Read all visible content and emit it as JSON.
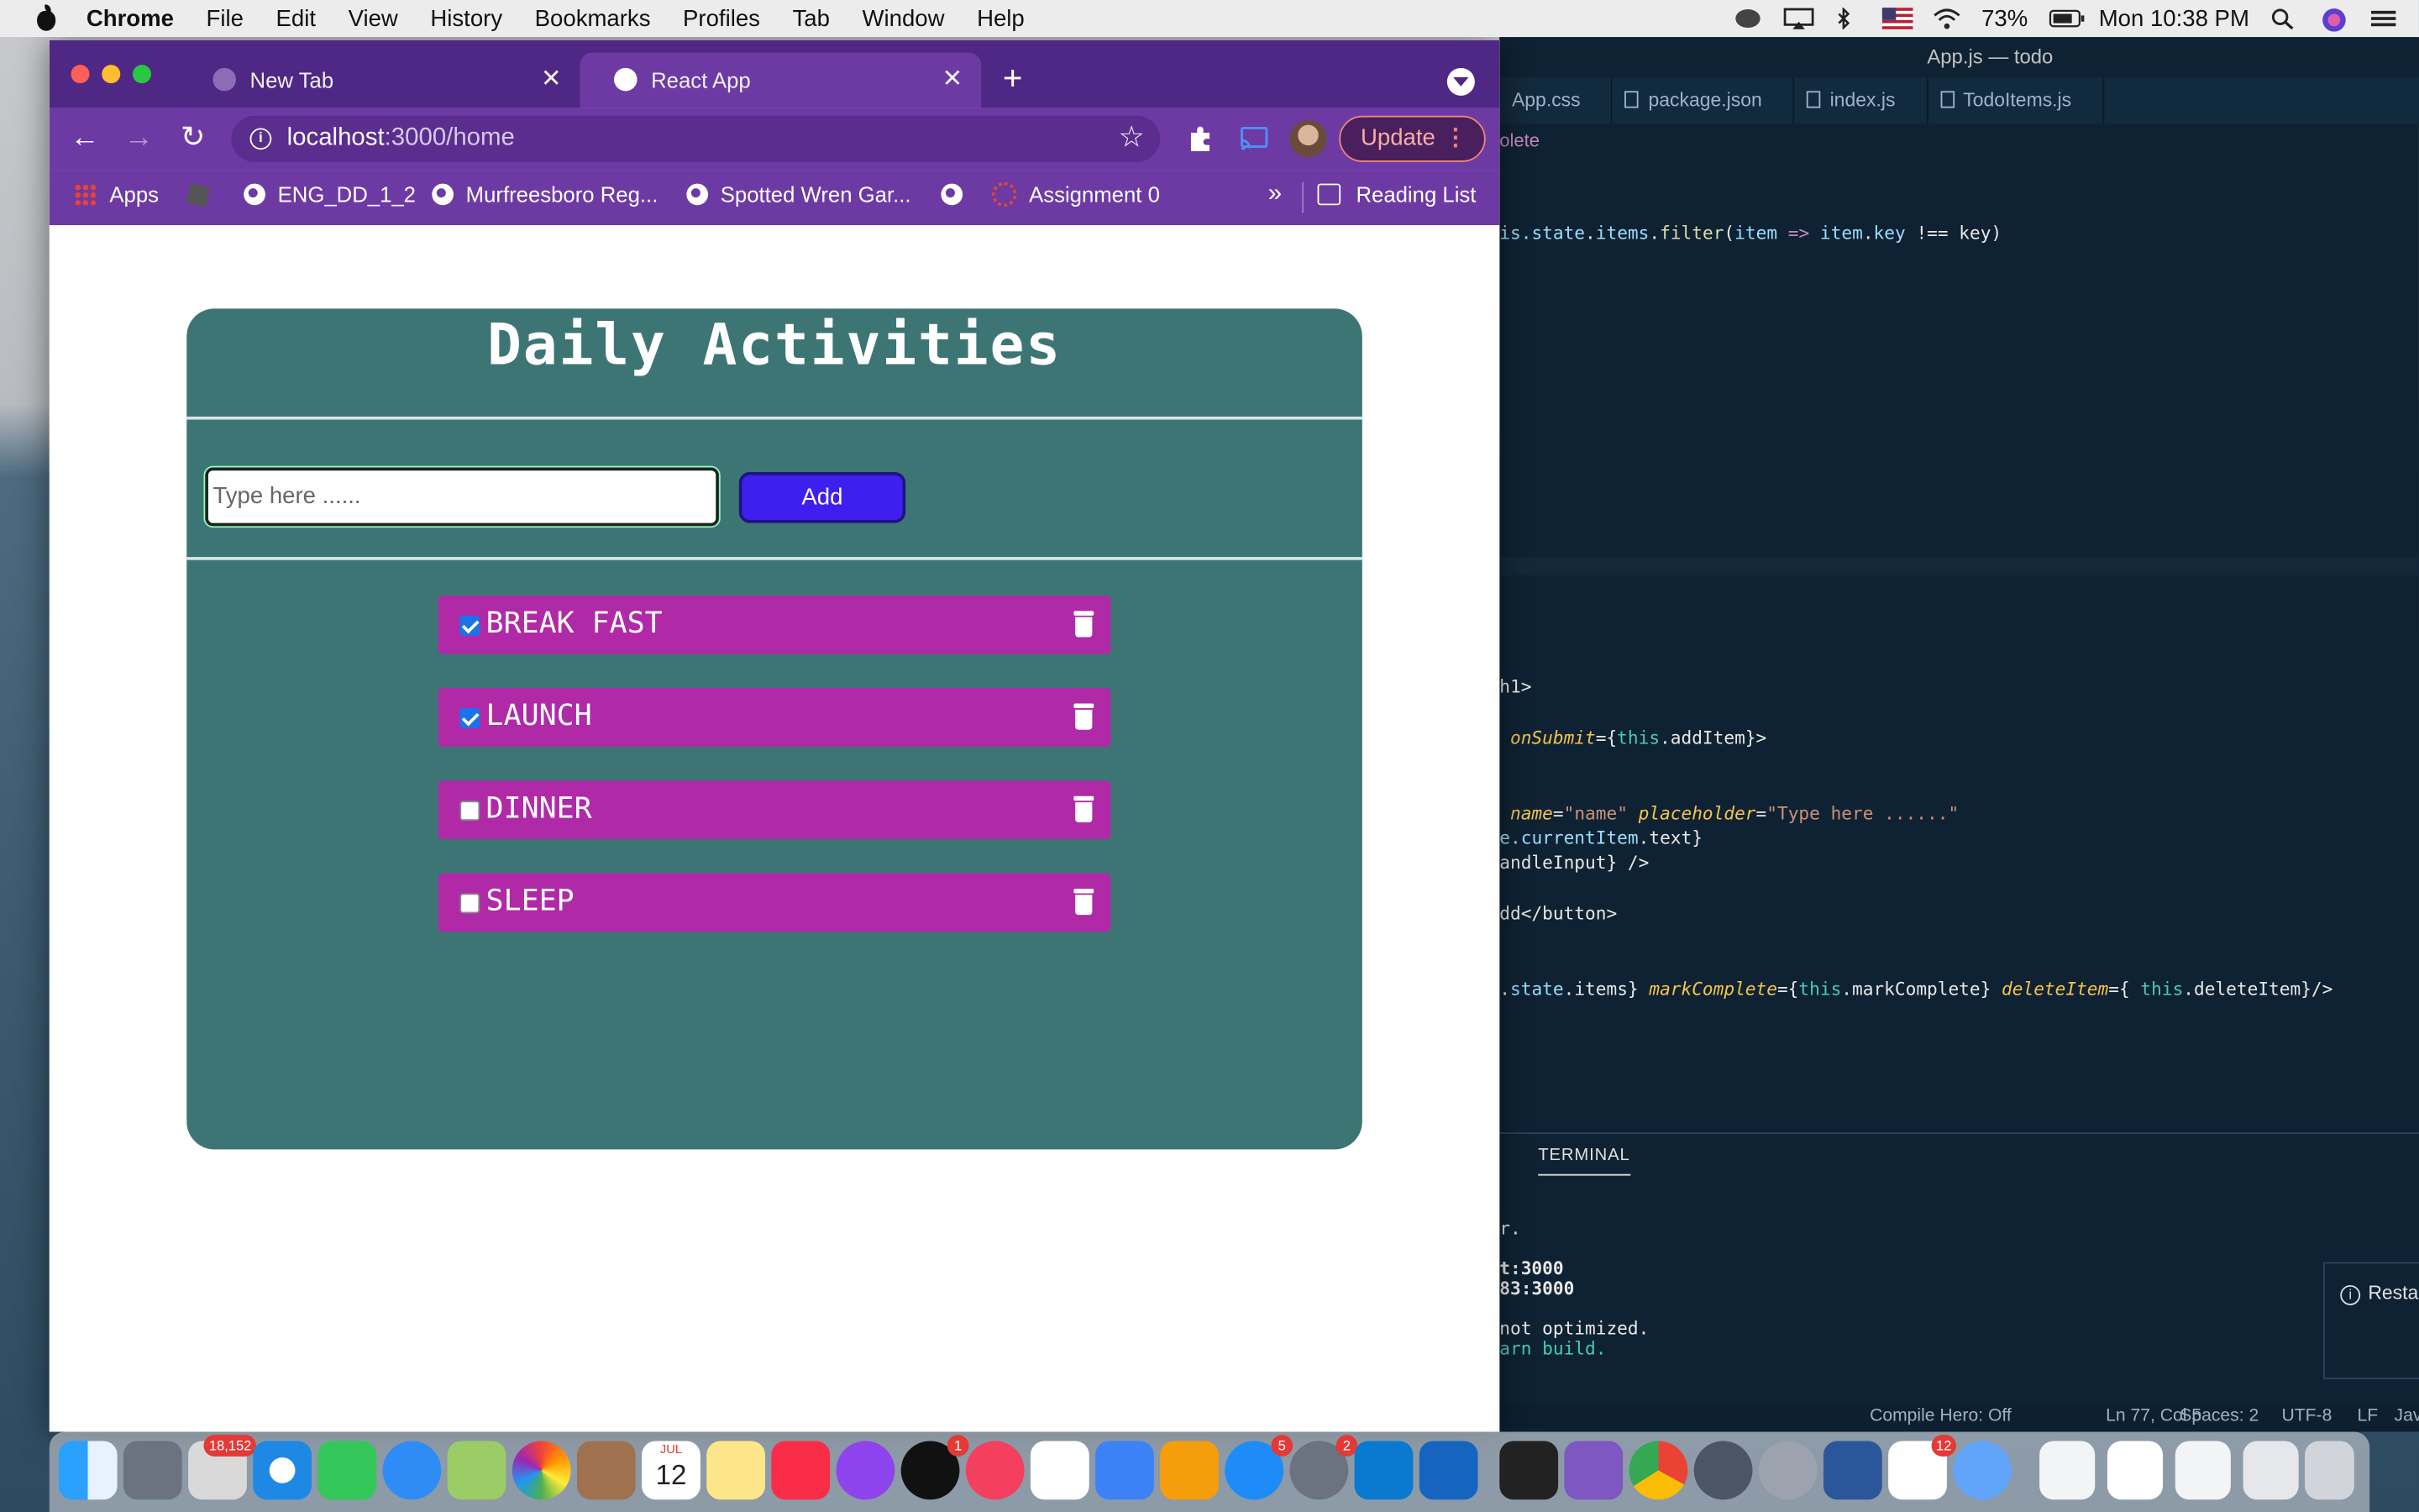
{
  "menubar": {
    "items": [
      "Chrome",
      "File",
      "Edit",
      "View",
      "History",
      "Bookmarks",
      "Profiles",
      "Tab",
      "Window",
      "Help"
    ],
    "battery": "73%",
    "clock": "Mon 10:38 PM"
  },
  "chrome": {
    "tabs": [
      {
        "title": "New Tab"
      },
      {
        "title": "React App"
      }
    ],
    "url_host": "localhost",
    "url_rest": ":3000/home",
    "update_label": "Update",
    "bookmarks": [
      "Apps",
      "ENG_DD_1_2",
      "Murfreesboro Reg...",
      "Spotted Wren Gar...",
      "Assignment 0"
    ],
    "reading_list": "Reading List",
    "more": "»"
  },
  "app": {
    "title": "Daily Activities",
    "input_placeholder": "Type here ......",
    "add_label": "Add",
    "items": [
      {
        "label": "BREAK FAST",
        "checked": true
      },
      {
        "label": "LAUNCH",
        "checked": true
      },
      {
        "label": "DINNER",
        "checked": false
      },
      {
        "label": "SLEEP",
        "checked": false
      }
    ]
  },
  "vscode": {
    "window_title": "App.js — todo",
    "tabs": [
      "App.css",
      "package.json",
      "index.js",
      "TodoItems.js"
    ],
    "breadcrumb_fragment": "olete",
    "code": {
      "l1_a": "is.",
      "l1_b": "state",
      "l1_c": ".",
      "l1_d": "items",
      "l1_e": ".",
      "l1_f": "filter",
      "l1_g": "(",
      "l1_h": "item",
      "l1_i": " => ",
      "l1_j": "item",
      "l1_k": ".",
      "l1_l": "key",
      "l1_m": " !== key)",
      "l2": "h1>",
      "l3_a": " onSubmit",
      "l3_b": "={",
      "l3_c": "this",
      "l3_d": ".addItem}>",
      "l4_a": " name",
      "l4_b": "=",
      "l4_c": "\"name\"",
      "l4_d": " placeholder",
      "l4_e": "=",
      "l4_f": "\"Type here ......\"",
      "l5_a": "e.",
      "l5_b": "currentItem",
      "l5_c": ".text}",
      "l6": "andleInput} />",
      "l7": "dd</button>",
      "l8_a": ".",
      "l8_b": "state",
      "l8_c": ".items} ",
      "l8_d": "markComplete",
      "l8_e": "={",
      "l8_f": "this",
      "l8_g": ".markComplete} ",
      "l8_h": "deleteItem",
      "l8_i": "={ ",
      "l8_j": "this",
      "l8_k": ".deleteItem}/>"
    },
    "panel_tab": "TERMINAL",
    "terminal": [
      "r.",
      "t:3000",
      "83:3000",
      "not optimized.",
      "arn build."
    ],
    "notification": "Resta",
    "status": {
      "compile": "Compile Hero: Off",
      "position": "Ln 77, Col 5",
      "spaces": "Spaces: 2",
      "encoding": "UTF-8",
      "eol": "LF",
      "lang": "Jav"
    }
  },
  "dock": {
    "badges": {
      "mail": "18,152",
      "calendar_month": "JUL",
      "calendar_day": "12",
      "tv": "1",
      "appstore": "5",
      "prefs": "2",
      "slack": "12"
    }
  }
}
